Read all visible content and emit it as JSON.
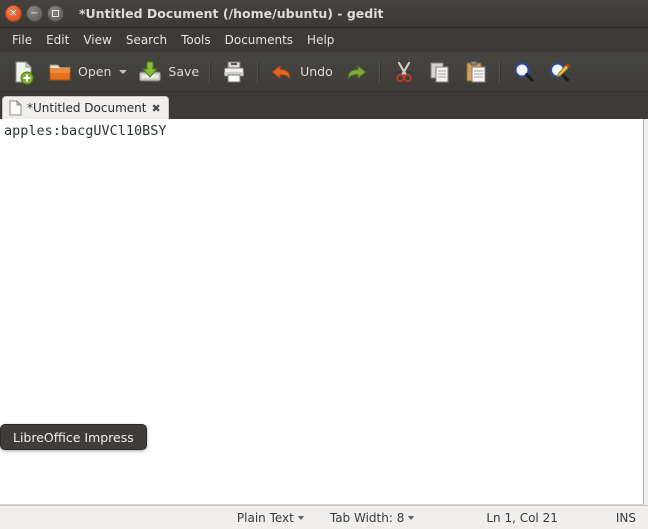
{
  "window": {
    "title": "*Untitled Document (/home/ubuntu) - gedit",
    "controls": {
      "close": "✕",
      "minimize": "−",
      "maximize": ""
    }
  },
  "menubar": {
    "items": [
      {
        "label": "File"
      },
      {
        "label": "Edit"
      },
      {
        "label": "View"
      },
      {
        "label": "Search"
      },
      {
        "label": "Tools"
      },
      {
        "label": "Documents"
      },
      {
        "label": "Help"
      }
    ]
  },
  "toolbar": {
    "new_label": "",
    "open_label": "Open",
    "save_label": "Save",
    "print_label": "",
    "undo_label": "Undo",
    "redo_label": "",
    "cut_label": "",
    "copy_label": "",
    "paste_label": "",
    "find_label": "",
    "replace_label": ""
  },
  "tabs": [
    {
      "title": "*Untitled Document",
      "close": "✖"
    }
  ],
  "editor": {
    "lines": [
      "apples:bacgUVCl10BSY"
    ]
  },
  "tooltip": {
    "text": "LibreOffice Impress"
  },
  "statusbar": {
    "language": "Plain Text",
    "tab_width": "Tab Width: 8",
    "cursor": "Ln 1, Col 21",
    "insert_mode": "INS"
  },
  "colors": {
    "titlebar": "#3c3a36",
    "toolbar": "#413f3b",
    "accent_close": "#df5b28",
    "editor_bg": "#ffffff",
    "text": "#2e3436",
    "statusbar_bg": "#f0efee",
    "tooltip_bg": "#3e3d39"
  }
}
